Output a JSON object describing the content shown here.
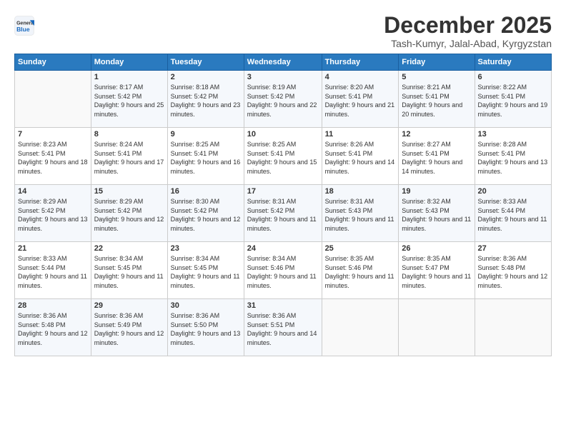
{
  "header": {
    "logo_general": "General",
    "logo_blue": "Blue",
    "month_title": "December 2025",
    "location": "Tash-Kumyr, Jalal-Abad, Kyrgyzstan"
  },
  "days_of_week": [
    "Sunday",
    "Monday",
    "Tuesday",
    "Wednesday",
    "Thursday",
    "Friday",
    "Saturday"
  ],
  "weeks": [
    [
      {
        "num": "",
        "sunrise": "",
        "sunset": "",
        "daylight": ""
      },
      {
        "num": "1",
        "sunrise": "Sunrise: 8:17 AM",
        "sunset": "Sunset: 5:42 PM",
        "daylight": "Daylight: 9 hours and 25 minutes."
      },
      {
        "num": "2",
        "sunrise": "Sunrise: 8:18 AM",
        "sunset": "Sunset: 5:42 PM",
        "daylight": "Daylight: 9 hours and 23 minutes."
      },
      {
        "num": "3",
        "sunrise": "Sunrise: 8:19 AM",
        "sunset": "Sunset: 5:42 PM",
        "daylight": "Daylight: 9 hours and 22 minutes."
      },
      {
        "num": "4",
        "sunrise": "Sunrise: 8:20 AM",
        "sunset": "Sunset: 5:41 PM",
        "daylight": "Daylight: 9 hours and 21 minutes."
      },
      {
        "num": "5",
        "sunrise": "Sunrise: 8:21 AM",
        "sunset": "Sunset: 5:41 PM",
        "daylight": "Daylight: 9 hours and 20 minutes."
      },
      {
        "num": "6",
        "sunrise": "Sunrise: 8:22 AM",
        "sunset": "Sunset: 5:41 PM",
        "daylight": "Daylight: 9 hours and 19 minutes."
      }
    ],
    [
      {
        "num": "7",
        "sunrise": "Sunrise: 8:23 AM",
        "sunset": "Sunset: 5:41 PM",
        "daylight": "Daylight: 9 hours and 18 minutes."
      },
      {
        "num": "8",
        "sunrise": "Sunrise: 8:24 AM",
        "sunset": "Sunset: 5:41 PM",
        "daylight": "Daylight: 9 hours and 17 minutes."
      },
      {
        "num": "9",
        "sunrise": "Sunrise: 8:25 AM",
        "sunset": "Sunset: 5:41 PM",
        "daylight": "Daylight: 9 hours and 16 minutes."
      },
      {
        "num": "10",
        "sunrise": "Sunrise: 8:25 AM",
        "sunset": "Sunset: 5:41 PM",
        "daylight": "Daylight: 9 hours and 15 minutes."
      },
      {
        "num": "11",
        "sunrise": "Sunrise: 8:26 AM",
        "sunset": "Sunset: 5:41 PM",
        "daylight": "Daylight: 9 hours and 14 minutes."
      },
      {
        "num": "12",
        "sunrise": "Sunrise: 8:27 AM",
        "sunset": "Sunset: 5:41 PM",
        "daylight": "Daylight: 9 hours and 14 minutes."
      },
      {
        "num": "13",
        "sunrise": "Sunrise: 8:28 AM",
        "sunset": "Sunset: 5:41 PM",
        "daylight": "Daylight: 9 hours and 13 minutes."
      }
    ],
    [
      {
        "num": "14",
        "sunrise": "Sunrise: 8:29 AM",
        "sunset": "Sunset: 5:42 PM",
        "daylight": "Daylight: 9 hours and 13 minutes."
      },
      {
        "num": "15",
        "sunrise": "Sunrise: 8:29 AM",
        "sunset": "Sunset: 5:42 PM",
        "daylight": "Daylight: 9 hours and 12 minutes."
      },
      {
        "num": "16",
        "sunrise": "Sunrise: 8:30 AM",
        "sunset": "Sunset: 5:42 PM",
        "daylight": "Daylight: 9 hours and 12 minutes."
      },
      {
        "num": "17",
        "sunrise": "Sunrise: 8:31 AM",
        "sunset": "Sunset: 5:42 PM",
        "daylight": "Daylight: 9 hours and 11 minutes."
      },
      {
        "num": "18",
        "sunrise": "Sunrise: 8:31 AM",
        "sunset": "Sunset: 5:43 PM",
        "daylight": "Daylight: 9 hours and 11 minutes."
      },
      {
        "num": "19",
        "sunrise": "Sunrise: 8:32 AM",
        "sunset": "Sunset: 5:43 PM",
        "daylight": "Daylight: 9 hours and 11 minutes."
      },
      {
        "num": "20",
        "sunrise": "Sunrise: 8:33 AM",
        "sunset": "Sunset: 5:44 PM",
        "daylight": "Daylight: 9 hours and 11 minutes."
      }
    ],
    [
      {
        "num": "21",
        "sunrise": "Sunrise: 8:33 AM",
        "sunset": "Sunset: 5:44 PM",
        "daylight": "Daylight: 9 hours and 11 minutes."
      },
      {
        "num": "22",
        "sunrise": "Sunrise: 8:34 AM",
        "sunset": "Sunset: 5:45 PM",
        "daylight": "Daylight: 9 hours and 11 minutes."
      },
      {
        "num": "23",
        "sunrise": "Sunrise: 8:34 AM",
        "sunset": "Sunset: 5:45 PM",
        "daylight": "Daylight: 9 hours and 11 minutes."
      },
      {
        "num": "24",
        "sunrise": "Sunrise: 8:34 AM",
        "sunset": "Sunset: 5:46 PM",
        "daylight": "Daylight: 9 hours and 11 minutes."
      },
      {
        "num": "25",
        "sunrise": "Sunrise: 8:35 AM",
        "sunset": "Sunset: 5:46 PM",
        "daylight": "Daylight: 9 hours and 11 minutes."
      },
      {
        "num": "26",
        "sunrise": "Sunrise: 8:35 AM",
        "sunset": "Sunset: 5:47 PM",
        "daylight": "Daylight: 9 hours and 11 minutes."
      },
      {
        "num": "27",
        "sunrise": "Sunrise: 8:36 AM",
        "sunset": "Sunset: 5:48 PM",
        "daylight": "Daylight: 9 hours and 12 minutes."
      }
    ],
    [
      {
        "num": "28",
        "sunrise": "Sunrise: 8:36 AM",
        "sunset": "Sunset: 5:48 PM",
        "daylight": "Daylight: 9 hours and 12 minutes."
      },
      {
        "num": "29",
        "sunrise": "Sunrise: 8:36 AM",
        "sunset": "Sunset: 5:49 PM",
        "daylight": "Daylight: 9 hours and 12 minutes."
      },
      {
        "num": "30",
        "sunrise": "Sunrise: 8:36 AM",
        "sunset": "Sunset: 5:50 PM",
        "daylight": "Daylight: 9 hours and 13 minutes."
      },
      {
        "num": "31",
        "sunrise": "Sunrise: 8:36 AM",
        "sunset": "Sunset: 5:51 PM",
        "daylight": "Daylight: 9 hours and 14 minutes."
      },
      {
        "num": "",
        "sunrise": "",
        "sunset": "",
        "daylight": ""
      },
      {
        "num": "",
        "sunrise": "",
        "sunset": "",
        "daylight": ""
      },
      {
        "num": "",
        "sunrise": "",
        "sunset": "",
        "daylight": ""
      }
    ]
  ]
}
